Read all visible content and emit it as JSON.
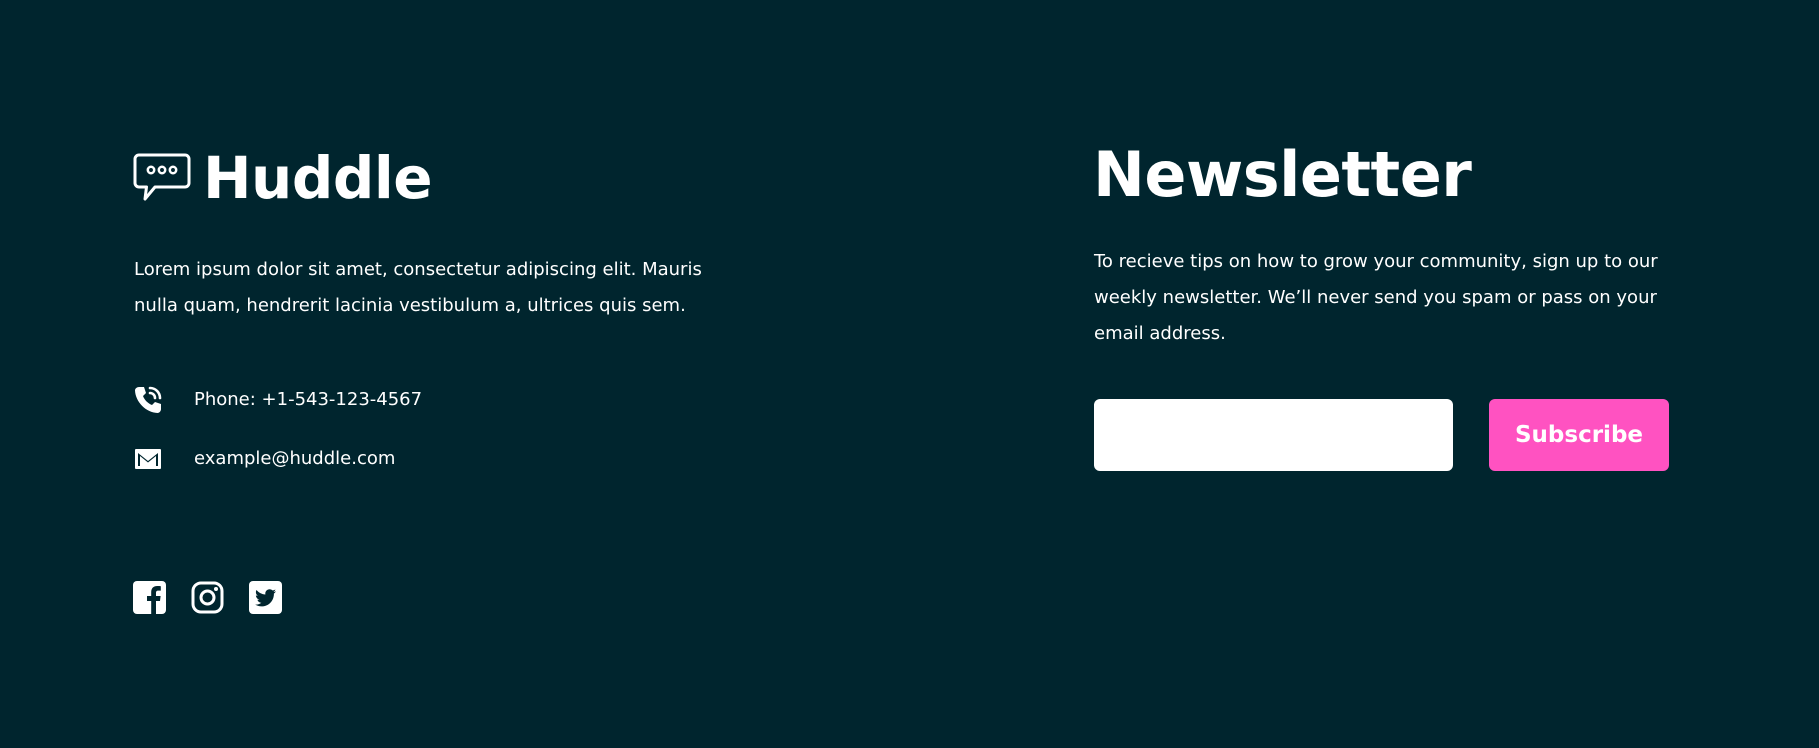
{
  "brand": {
    "name": "Huddle",
    "icon": "chat-bubble-icon"
  },
  "about": {
    "text": "Lorem ipsum dolor sit amet, consectetur adipiscing elit. Mauris nulla quam, hendrerit lacinia vestibulum a, ultrices quis sem."
  },
  "contact": {
    "phone": "Phone: +1-543-123-4567",
    "email": "example@huddle.com",
    "phone_icon": "phone-icon",
    "email_icon": "email-icon"
  },
  "socials": [
    {
      "icon": "facebook-icon"
    },
    {
      "icon": "instagram-icon"
    },
    {
      "icon": "twitter-icon"
    }
  ],
  "newsletter": {
    "title": "Newsletter",
    "text": "To recieve tips on how to grow your community, sign up to our weekly newsletter. We’ll never send you spam or pass on your email address.",
    "input_value": "",
    "input_placeholder": "",
    "button_label": "Subscribe"
  },
  "colors": {
    "background": "#00252e",
    "accent": "#ff52c1",
    "text": "#ffffff",
    "input_background": "#ffffff"
  }
}
